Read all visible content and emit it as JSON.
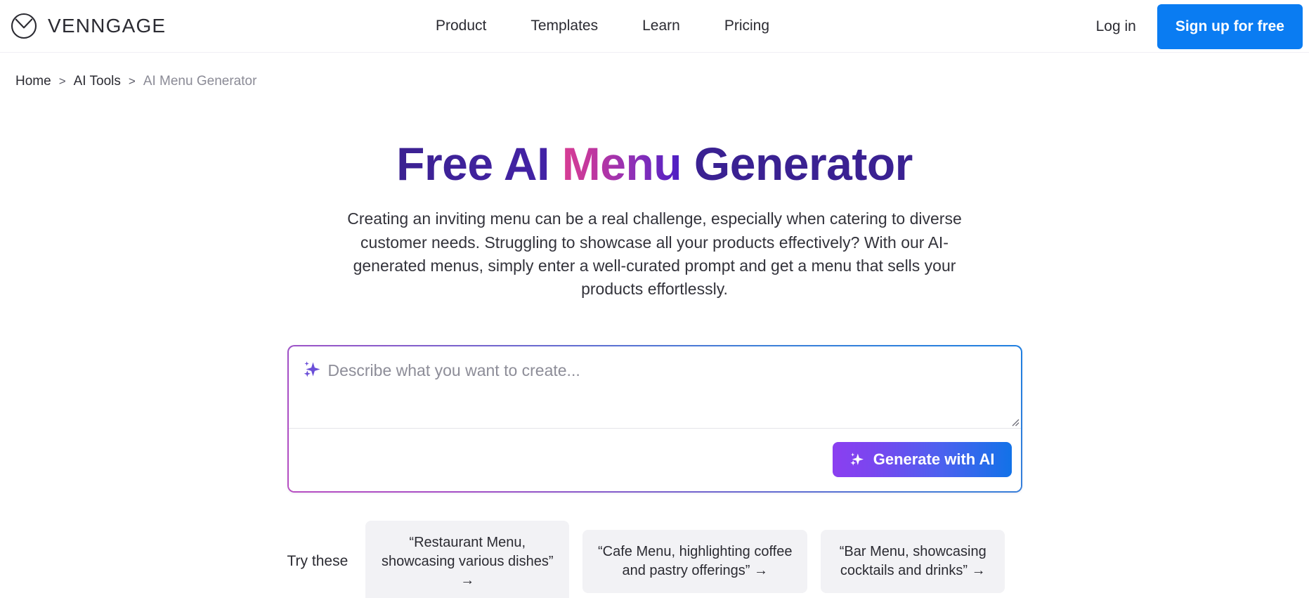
{
  "header": {
    "brand": {
      "name": "VENNGAGE",
      "logo_icon": "venngage-circle-chevron-logo"
    },
    "nav": [
      {
        "label": "Product"
      },
      {
        "label": "Templates"
      },
      {
        "label": "Learn"
      },
      {
        "label": "Pricing"
      }
    ],
    "login_label": "Log in",
    "signup_label": "Sign up for free",
    "signup_color": "#0a7cf2"
  },
  "breadcrumb": {
    "items": [
      {
        "label": "Home",
        "current": false
      },
      {
        "label": "AI Tools",
        "current": false
      },
      {
        "label": "AI Menu Generator",
        "current": true
      }
    ],
    "separator": ">"
  },
  "hero": {
    "title_part1": "Free AI ",
    "title_part2": "Menu",
    "title_part3": " Generator",
    "subtitle": "Creating an inviting menu can be a real challenge, especially when catering to diverse customer needs. Struggling to showcase all your products effectively? With our AI-generated menus, simply enter a well-curated prompt and get a menu that sells your products effortlessly.",
    "title_gradient_start": "#d83d93",
    "title_gradient_end": "#3b2191"
  },
  "prompt": {
    "placeholder": "Describe what you want to create...",
    "value": "",
    "sparkle_icon": "sparkle-icon",
    "generate_label": "Generate with AI",
    "generate_icon": "sparkle-icon",
    "generate_gradient_start": "#8b3ff0",
    "generate_gradient_end": "#1272e8",
    "border_gradient_start": "#1f7fe0",
    "border_gradient_end": "#b84fc2"
  },
  "try_these": {
    "label": "Try these",
    "chips": [
      {
        "text": "“Restaurant Menu, showcasing various dishes” →"
      },
      {
        "text": "“Cafe Menu, highlighting coffee and pastry offerings” →"
      },
      {
        "text": "“Bar Menu, showcasing cocktails and drinks” →"
      }
    ]
  }
}
